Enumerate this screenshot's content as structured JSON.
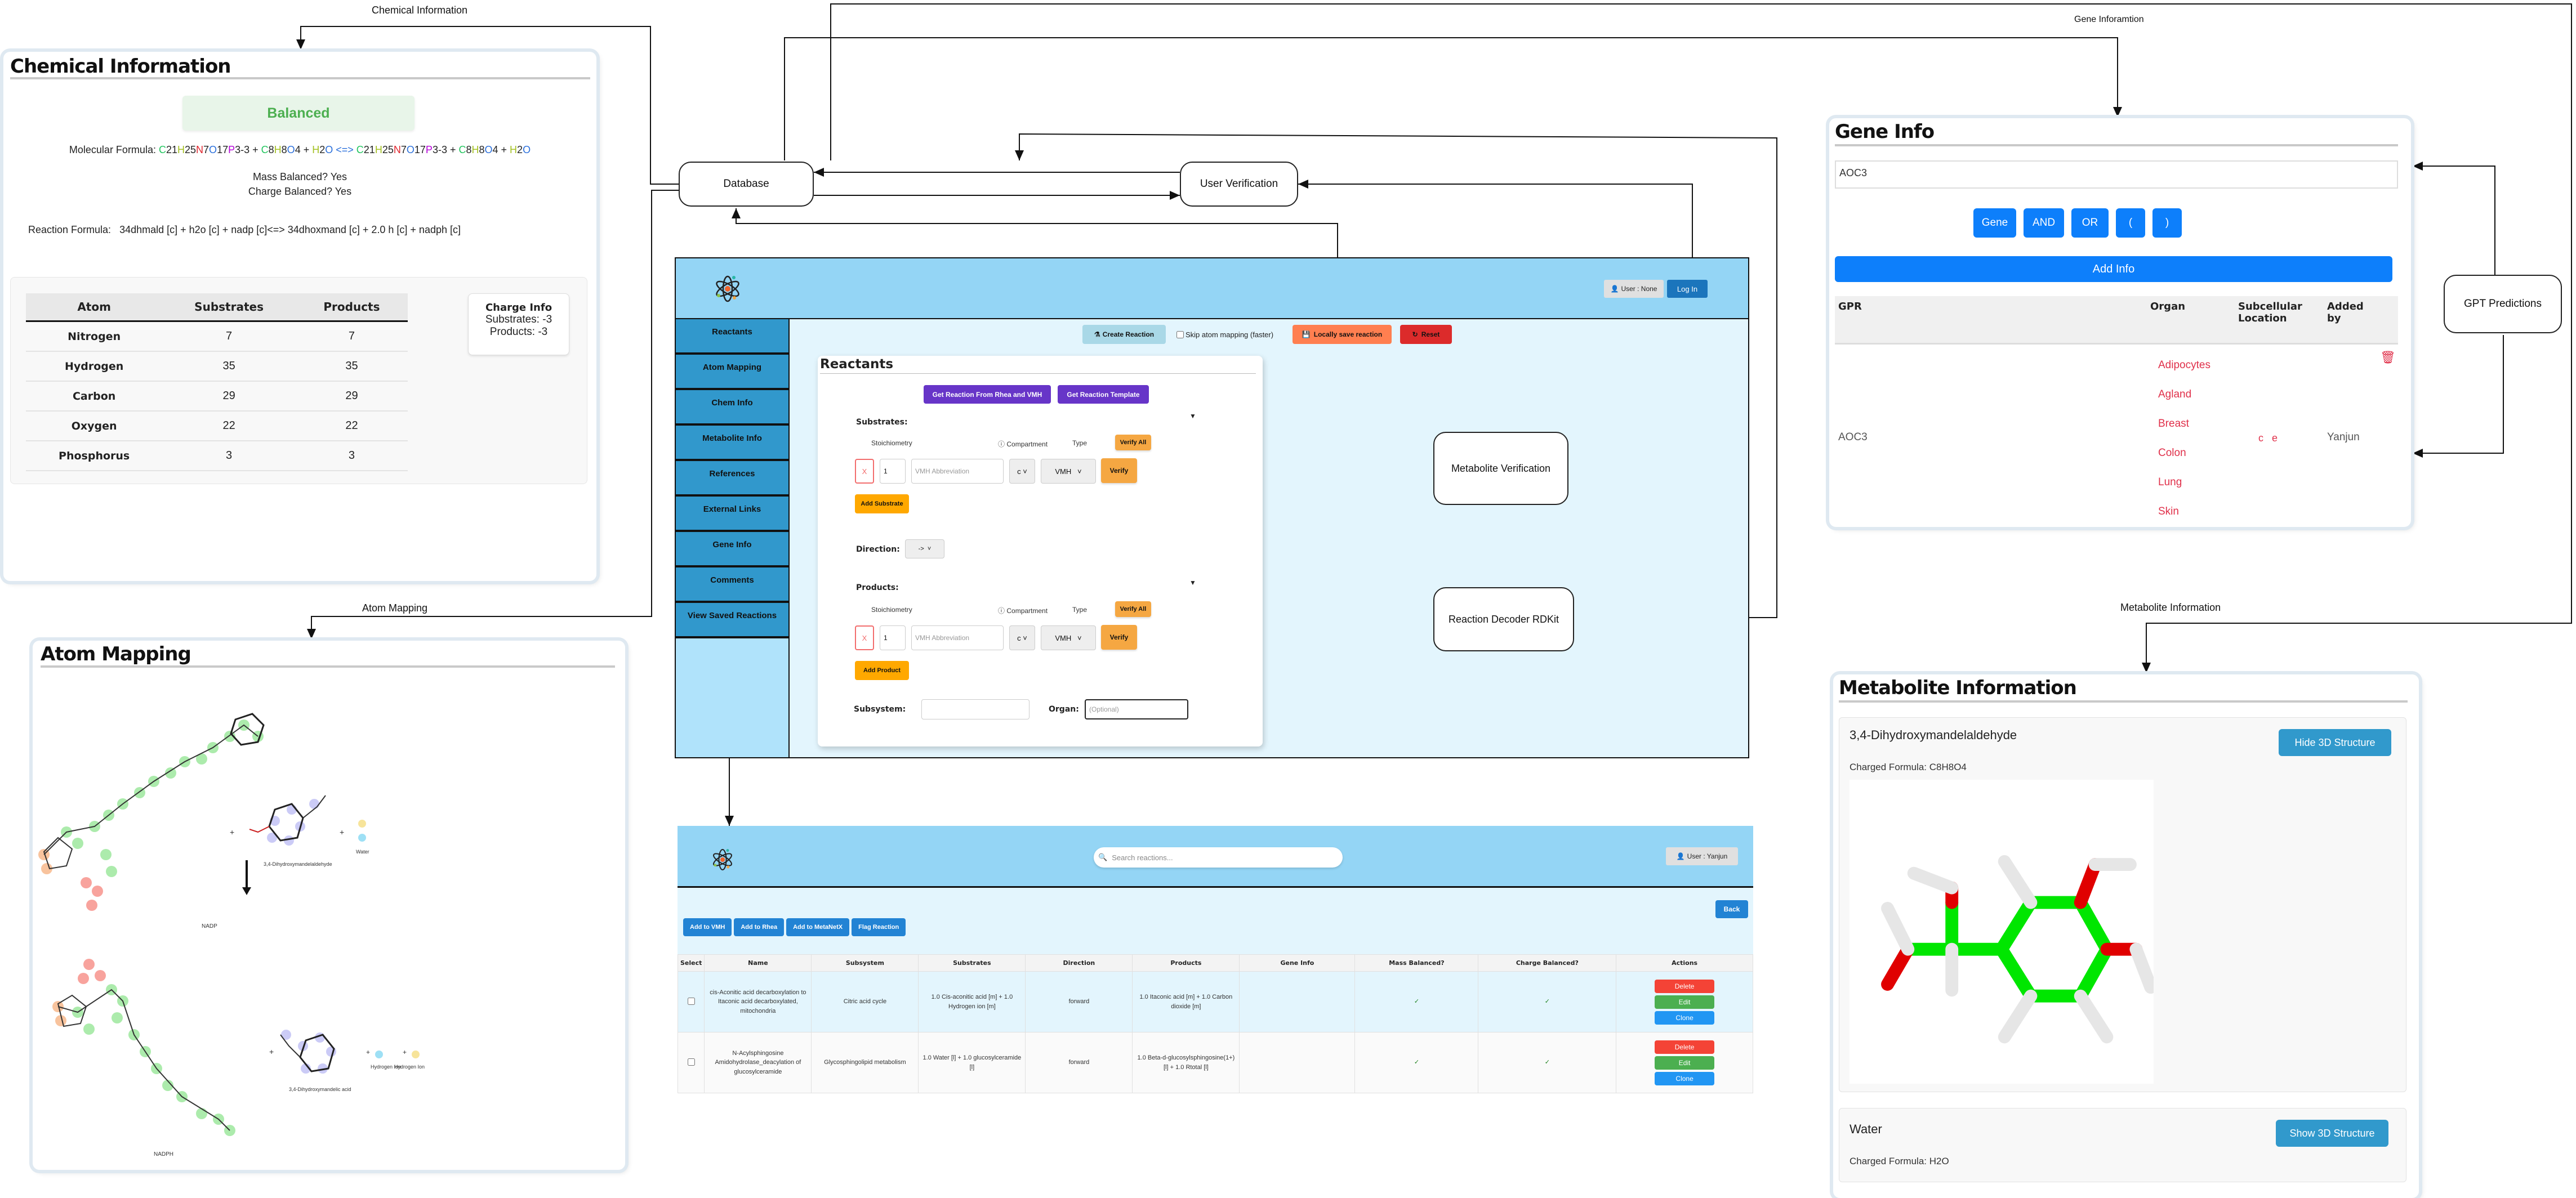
{
  "flow": {
    "labels": {
      "chemical_information": "Chemical Information",
      "gene_information": "Gene Inforamtion",
      "atom_mapping": "Atom Mapping",
      "metabolite_information": "Metabolite Information"
    },
    "boxes": {
      "database": "Database",
      "user_verification": "User Verification",
      "metabolite_verification": "Metabolite Verification",
      "reaction_decoder": "Reaction Decoder RDKit",
      "gpt_predictions": "GPT Predictions"
    }
  },
  "chemical_info": {
    "title": "Chemical Information",
    "status": "Balanced",
    "molecular_formula_label": "Molecular Formula:",
    "molecular_formula": {
      "left": [
        {
          "parts": [
            [
              "C",
              "21"
            ],
            [
              "H",
              "25"
            ],
            [
              "N",
              "7"
            ],
            [
              "O",
              "17"
            ],
            [
              "P",
              "3-3"
            ]
          ]
        },
        {
          "parts": [
            [
              "C",
              "8"
            ],
            [
              "H",
              "8"
            ],
            [
              "O",
              "4"
            ]
          ]
        },
        {
          "parts": [
            [
              "H",
              "2"
            ],
            [
              "O",
              ""
            ]
          ]
        }
      ],
      "arrow": "<=>",
      "right": [
        {
          "parts": [
            [
              "C",
              "21"
            ],
            [
              "H",
              "25"
            ],
            [
              "N",
              "7"
            ],
            [
              "O",
              "17"
            ],
            [
              "P",
              "3-3"
            ]
          ]
        },
        {
          "parts": [
            [
              "C",
              "8"
            ],
            [
              "H",
              "8"
            ],
            [
              "O",
              "4"
            ]
          ]
        },
        {
          "parts": [
            [
              "H",
              "2"
            ],
            [
              "O",
              ""
            ]
          ]
        }
      ]
    },
    "mass_balanced": "Mass Balanced? Yes",
    "charge_balanced": "Charge Balanced? Yes",
    "reaction_formula_label": "Reaction Formula:",
    "reaction_formula": "34dhmald [c] + h2o [c] + nadp [c]<=> 34dhoxmand [c] + 2.0 h [c] + nadph [c]",
    "table": {
      "headers": [
        "Atom",
        "Substrates",
        "Products"
      ],
      "rows": [
        [
          "Nitrogen",
          "7",
          "7"
        ],
        [
          "Hydrogen",
          "35",
          "35"
        ],
        [
          "Carbon",
          "29",
          "29"
        ],
        [
          "Oxygen",
          "22",
          "22"
        ],
        [
          "Phosphorus",
          "3",
          "3"
        ]
      ]
    },
    "charge_info": {
      "title": "Charge Info",
      "substrates": "Substrates: -3",
      "products": "Products: -3"
    }
  },
  "atom_mapping": {
    "title": "Atom Mapping",
    "reactants": [
      "NADP",
      "3,4-Dihydroxymandelaldehyde",
      "Water"
    ],
    "products": [
      "NADPH",
      "3,4-Dihydroxymandelic acid",
      "Hydrogen Ion",
      "Hydrogen Ion"
    ],
    "plus": "+"
  },
  "reaction_app": {
    "user_label": "User : None",
    "login_label": "Log In",
    "sidebar": [
      "Reactants",
      "Atom Mapping",
      "Chem Info",
      "Metabolite Info",
      "References",
      "External Links",
      "Gene Info",
      "Comments",
      "View Saved Reactions"
    ],
    "toolbar": {
      "create_reaction": "Create Reaction",
      "skip_atom_mapping": "Skip atom mapping (faster)",
      "skip_checked": false,
      "locally_save": "Locally save reaction",
      "reset": "Reset"
    },
    "reactants_card": {
      "title": "Reactants",
      "get_from_rhea": "Get Reaction From Rhea and VMH",
      "get_template": "Get Reaction Template",
      "substrates_label": "Substrates:",
      "products_label": "Products:",
      "col_stoichiometry": "Stoichiometry",
      "col_compartment": "Compartment",
      "col_type": "Type",
      "verify_all": "Verify All",
      "remove": "X",
      "stoich_value": "1",
      "vmh_placeholder": "VMH Abbreviation",
      "compartment_value": "c",
      "type_value": "VMH",
      "verify": "Verify",
      "add_substrate": "Add Substrate",
      "add_product": "Add Product",
      "direction_label": "Direction:",
      "direction_value": "->",
      "subsystem_label": "Subsystem:",
      "subsystem_value": "",
      "organ_label": "Organ:",
      "organ_placeholder": "(Optional)"
    }
  },
  "gene_info": {
    "title": "Gene Info",
    "input_value": "AOC3",
    "token_buttons": [
      "Gene",
      "AND",
      "OR",
      "(",
      ")"
    ],
    "add_info": "Add Info",
    "table": {
      "headers": [
        "GPR",
        "Organ",
        "Subcellular Location",
        "Added by"
      ],
      "row": {
        "gpr": "AOC3",
        "organs": [
          "Adipocytes",
          "Agland",
          "Breast",
          "Colon",
          "Lung",
          "Skin"
        ],
        "subcellular": [
          "c",
          "e"
        ],
        "added_by": "Yanjun"
      }
    }
  },
  "metabolite_info": {
    "title": "Metabolite Information",
    "cards": [
      {
        "name": "3,4-Dihydroxymandelaldehyde",
        "formula": "Charged Formula: C8H8O4",
        "button": "Hide 3D Structure"
      },
      {
        "name": "Water",
        "formula": "Charged Formula: H2O",
        "button": "Show 3D Structure"
      }
    ]
  },
  "saved_reactions": {
    "search_placeholder": "Search reactions...",
    "user_label": "User : Yanjun",
    "back": "Back",
    "actions": [
      "Add to VMH",
      "Add to Rhea",
      "Add to MetaNetX",
      "Flag Reaction"
    ],
    "headers": [
      "Select",
      "Name",
      "Subsystem",
      "Substrates",
      "Direction",
      "Products",
      "Gene Info",
      "Mass Balanced?",
      "Charge Balanced?",
      "Actions"
    ],
    "rows": [
      {
        "name": "cis-Aconitic acid decarboxylation to Itaconic acid decarboxylated, mitochondria",
        "subsystem": "Citric acid cycle",
        "substrates": "1.0 Cis-aconitic acid [m] + 1.0 Hydrogen ion [m]",
        "direction": "forward",
        "products": "1.0 Itaconic acid [m] + 1.0 Carbon dioxide [m]",
        "gene_info": "",
        "mass_balanced": "✓",
        "charge_balanced": "✓"
      },
      {
        "name": "N-Acylsphingosine Amidohydrolase_deacylation of glucosylceramide",
        "subsystem": "Glycosphingolipid metabolism",
        "substrates": "1.0 Water [l] + 1.0 glucosylceramide [l]",
        "direction": "forward",
        "products": "1.0 Beta-d-glucosylsphingosine(1+) [l] + 1.0 Rtotal [l]",
        "gene_info": "",
        "mass_balanced": "✓",
        "charge_balanced": "✓"
      }
    ],
    "row_buttons": [
      "Delete",
      "Edit",
      "Clone"
    ]
  },
  "colors": {
    "header_blue": "#94d5f5",
    "sidebar_blue": "#3198cc",
    "panel_bg": "#e3f5fd",
    "purple": "#6735c8",
    "orange": "#f5a742",
    "primary_blue": "#0d7ffb",
    "delete_red": "#f44336",
    "edit_green": "#4caf50",
    "clone_blue": "#2196f3",
    "balanced_green": "#4caf50"
  }
}
